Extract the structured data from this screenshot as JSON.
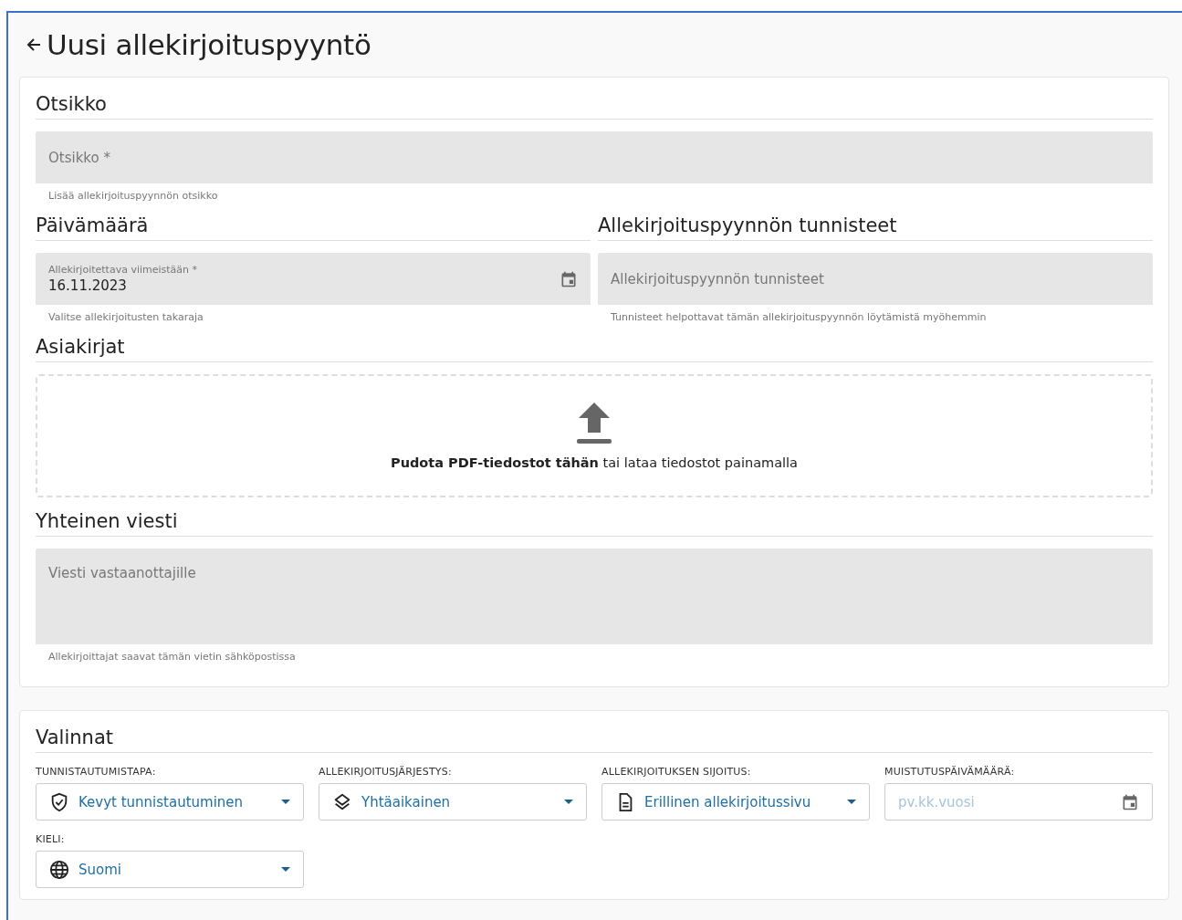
{
  "page": {
    "title": "Uusi allekirjoituspyyntö"
  },
  "details": {
    "title_section": {
      "heading": "Otsikko",
      "field": {
        "placeholder": "Otsikko *",
        "hint": "Lisää allekirjoituspyynnön otsikko"
      }
    },
    "date_section": {
      "heading": "Päivämäärä",
      "field": {
        "label": "Allekirjoitettava viimeistään *",
        "value": "16.11.2023",
        "hint": "Valitse allekirjoitusten takaraja"
      }
    },
    "tags_section": {
      "heading": "Allekirjoituspyynnön tunnisteet",
      "field": {
        "placeholder": "Allekirjoituspyynnön tunnisteet",
        "hint": "Tunnisteet helpottavat tämän allekirjoituspyynnön löytämistä myöhemmin"
      }
    },
    "documents_section": {
      "heading": "Asiakirjat",
      "dropzone": "**Pudota PDF-tiedostot tähän** tai lataa tiedostot painamalla"
    },
    "message_section": {
      "heading": "Yhteinen viesti",
      "field": {
        "placeholder": "Viesti vastaanottajille",
        "hint": "Allekirjoittajat saavat tämän vietin sähköpostissa"
      }
    }
  },
  "options": {
    "heading": "Valinnat",
    "fields": [
      {
        "kind": "select",
        "label": "TUNNISTAUTUMISTAPA:",
        "value": "Kevyt tunnistautuminen"
      },
      {
        "kind": "select",
        "label": "ALLEKIRJOITUSJÄRJESTYS:",
        "value": "Yhtäaikainen"
      },
      {
        "kind": "select",
        "label": "ALLEKIRJOITUKSEN SIJOITUS:",
        "value": "Erillinen allekirjoitussivu"
      },
      {
        "kind": "date",
        "label": "MUISTUTUSPÄIVÄMÄÄRÄ:",
        "placeholder": "pv.kk.vuosi"
      },
      {
        "kind": "select",
        "label": "KIELI:",
        "value": "Suomi"
      }
    ]
  }
}
